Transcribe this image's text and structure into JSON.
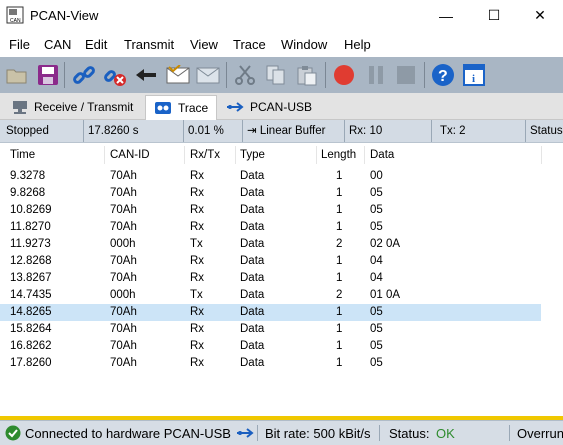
{
  "window": {
    "title": "PCAN-View"
  },
  "menu": {
    "file": "File",
    "can": "CAN",
    "edit": "Edit",
    "transmit": "Transmit",
    "view": "View",
    "trace": "Trace",
    "window": "Window",
    "help": "Help"
  },
  "tabs": [
    {
      "label": "Receive / Transmit"
    },
    {
      "label": "Trace"
    },
    {
      "label": "PCAN-USB"
    }
  ],
  "trace_status": {
    "state": "Stopped",
    "time": "17.8260 s",
    "fill": "0.01 %",
    "buffer": "Linear Buffer",
    "rx": "Rx: 10",
    "tx": "Tx: 2",
    "status": "Status"
  },
  "table": {
    "headers": [
      "Time",
      "CAN-ID",
      "Rx/Tx",
      "Type",
      "Length",
      "Data"
    ],
    "rows": [
      [
        "9.3278",
        "70Ah",
        "Rx",
        "Data",
        "1",
        "00"
      ],
      [
        "9.8268",
        "70Ah",
        "Rx",
        "Data",
        "1",
        "05"
      ],
      [
        "10.8269",
        "70Ah",
        "Rx",
        "Data",
        "1",
        "05"
      ],
      [
        "11.8270",
        "70Ah",
        "Rx",
        "Data",
        "1",
        "05"
      ],
      [
        "11.9273",
        "000h",
        "Tx",
        "Data",
        "2",
        "02 0A"
      ],
      [
        "12.8268",
        "70Ah",
        "Rx",
        "Data",
        "1",
        "04"
      ],
      [
        "13.8267",
        "70Ah",
        "Rx",
        "Data",
        "1",
        "04"
      ],
      [
        "14.7435",
        "000h",
        "Tx",
        "Data",
        "2",
        "01 0A"
      ],
      [
        "14.8265",
        "70Ah",
        "Rx",
        "Data",
        "1",
        "05"
      ],
      [
        "15.8264",
        "70Ah",
        "Rx",
        "Data",
        "1",
        "05"
      ],
      [
        "16.8262",
        "70Ah",
        "Rx",
        "Data",
        "1",
        "05"
      ],
      [
        "17.8260",
        "70Ah",
        "Rx",
        "Data",
        "1",
        "05"
      ]
    ],
    "selected_row": 8
  },
  "bottom": {
    "connection": "Connected to hardware PCAN-USB",
    "bitrate": "Bit rate: 500 kBit/s",
    "status_label": "Status:",
    "status_value": "OK",
    "overrun": "Overrun"
  },
  "colors": {
    "toolbar": "#a9b6c4",
    "selection": "#cce4f7",
    "status_ok": "#2e8b2e",
    "record": "#e03c31",
    "help": "#1a63c8"
  }
}
